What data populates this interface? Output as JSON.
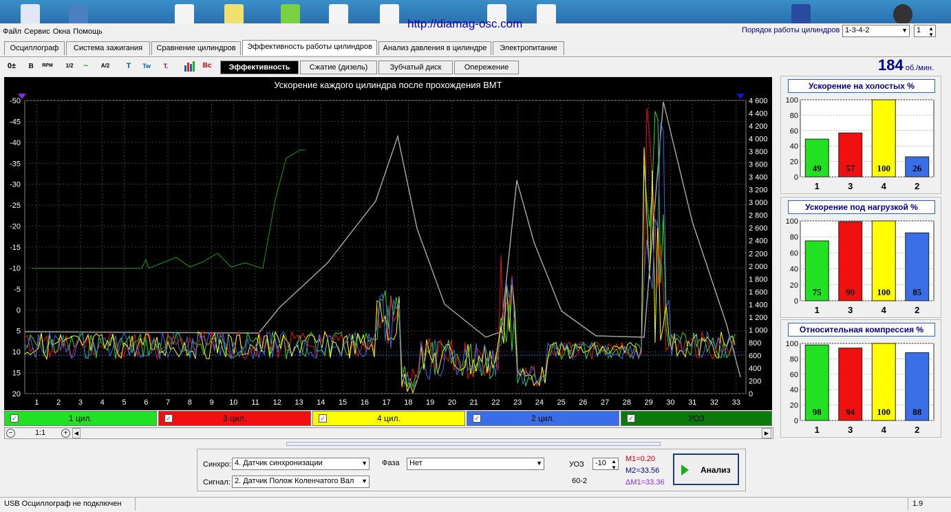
{
  "menu": [
    "Файл",
    "Сервис",
    "Окна",
    "Помощь"
  ],
  "url": "http://diamag-osc.com",
  "cyl_order": {
    "label": "Порядок работы цилиндров",
    "value": "1-3-4-2",
    "num": "1"
  },
  "tabs": [
    "Осциллограф",
    "Система зажигания",
    "Сравнение цилиндров",
    "Эффективность работы цилиндров",
    "Анализ давления в цилиндре",
    "Электропитание"
  ],
  "subtabs": [
    "Эффективность",
    "Сжатие (дизель)",
    "Зубчатый диск",
    "Опережение"
  ],
  "rpm": {
    "value": "184",
    "unit": "об./мин."
  },
  "toolbar_icons": [
    "0±",
    "B",
    "RPM",
    "1/2",
    "~",
    "A/2",
    "T",
    "Tw",
    "T.",
    "bars",
    "Bc"
  ],
  "scope": {
    "title": "Ускорение каждого цилиндра после прохождения ВМТ",
    "left_ticks": [
      "-50",
      "-45",
      "-40",
      "-35",
      "-30",
      "-25",
      "-20",
      "-15",
      "-10",
      "-5",
      "0",
      "5",
      "10",
      "15",
      "20"
    ],
    "right_ticks": [
      "4 600",
      "4 400",
      "4 200",
      "4 000",
      "3 800",
      "3 600",
      "3 400",
      "3 200",
      "3 000",
      "2 800",
      "2 600",
      "2 400",
      "2 200",
      "2 000",
      "1 800",
      "1 600",
      "1 400",
      "1 200",
      "1 000",
      "800",
      "600",
      "400",
      "200",
      "0"
    ],
    "x_ticks": [
      "1",
      "2",
      "3",
      "4",
      "5",
      "6",
      "7",
      "8",
      "9",
      "10",
      "11",
      "12",
      "13",
      "14",
      "15",
      "16",
      "17",
      "18",
      "19",
      "20",
      "21",
      "22",
      "23",
      "24",
      "25",
      "26",
      "27",
      "28",
      "29",
      "30",
      "31",
      "32",
      "33"
    ]
  },
  "legend": [
    {
      "label": "1 цил.",
      "color": "#22e022"
    },
    {
      "label": "3 цил.",
      "color": "#f01010"
    },
    {
      "label": "4 цил.",
      "color": "#ffff00"
    },
    {
      "label": "2 цил.",
      "color": "#3a6ee8"
    },
    {
      "label": "УОЗ",
      "color": "#0a7a0a"
    }
  ],
  "zoom": {
    "value": "1:1"
  },
  "chart_data": [
    {
      "type": "bar",
      "title": "Ускорение на холостых %",
      "categories": [
        "1",
        "3",
        "4",
        "2"
      ],
      "values": [
        49,
        57,
        100,
        26
      ],
      "colors": [
        "#22e022",
        "#f01010",
        "#ffff00",
        "#3a6ee8"
      ],
      "ylim": [
        0,
        100
      ],
      "yticks": [
        "100",
        "80",
        "60",
        "40",
        "20",
        "0"
      ]
    },
    {
      "type": "bar",
      "title": "Ускорение под нагрузкой %",
      "categories": [
        "1",
        "3",
        "4",
        "2"
      ],
      "values": [
        75,
        99,
        100,
        85
      ],
      "colors": [
        "#22e022",
        "#f01010",
        "#ffff00",
        "#3a6ee8"
      ],
      "ylim": [
        0,
        100
      ],
      "yticks": [
        "100",
        "80",
        "60",
        "40",
        "20",
        "0"
      ]
    },
    {
      "type": "bar",
      "title": "Относительная компрессия %",
      "categories": [
        "1",
        "3",
        "4",
        "2"
      ],
      "values": [
        98,
        94,
        100,
        88
      ],
      "colors": [
        "#22e022",
        "#f01010",
        "#ffff00",
        "#3a6ee8"
      ],
      "ylim": [
        0,
        100
      ],
      "yticks": [
        "100",
        "80",
        "60",
        "40",
        "20",
        "0"
      ]
    }
  ],
  "bottom": {
    "sync_label": "Синхро:",
    "sync_value": "4.  Датчик синхронизации",
    "signal_label": "Сигнал:",
    "signal_value": "2.  Датчик Полож Коленчатого Вал",
    "phase_label": "Фаза",
    "phase_value": "Нет",
    "uoz_label": "УОЗ",
    "uoz_value": "-10",
    "teeth": "60-2",
    "m1": "M1=0.20",
    "m2": "M2=33.56",
    "dm": "ΔM1=33.36",
    "analyze": "Анализ"
  },
  "status": {
    "text": "USB Осциллограф не подключен",
    "version": "1.9"
  }
}
